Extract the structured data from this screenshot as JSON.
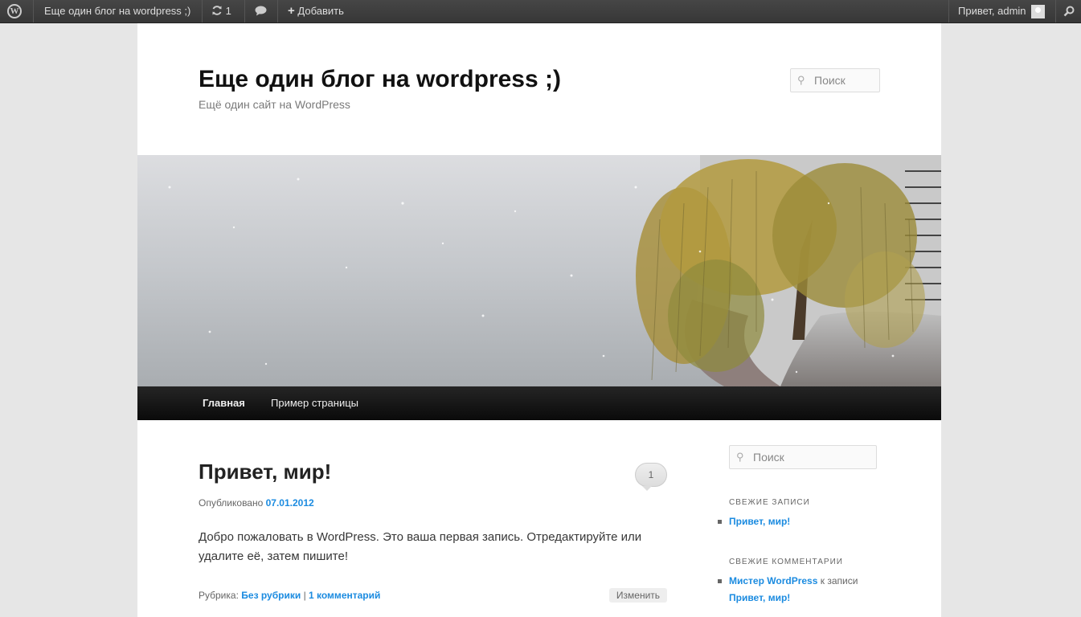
{
  "adminbar": {
    "site_name": "Еще один блог на wordpress ;)",
    "updates_count": "1",
    "add_label": "Добавить",
    "greeting": "Привет, admin"
  },
  "header": {
    "title": "Еще один блог на wordpress ;)",
    "description": "Ещё один сайт на WordPress",
    "search_placeholder": "Поиск"
  },
  "nav": {
    "items": [
      "Главная",
      "Пример страницы"
    ]
  },
  "post": {
    "title": "Привет, мир!",
    "comment_count": "1",
    "published_label": "Опубликовано",
    "date": "07.01.2012",
    "body_line1": "Добро пожаловать в WordPress. Это ваша первая запись. Отредактируйте или",
    "body_line2": "удалите её, затем пишите!",
    "category_label": "Рубрика:",
    "category": "Без рубрики",
    "separator": "|",
    "comments_link": "1 комментарий",
    "edit_label": "Изменить"
  },
  "sidebar": {
    "search_placeholder": "Поиск",
    "recent_posts_title": "СВЕЖИЕ ЗАПИСИ",
    "recent_posts": [
      "Привет, мир!"
    ],
    "recent_comments_title": "СВЕЖИЕ КОММЕНТАРИИ",
    "comment_author": "Мистер WordPress",
    "comment_on": "к записи",
    "comment_post": "Привет, мир!"
  },
  "colors": {
    "link": "#1b8be0",
    "adminbar": "#464646",
    "nav": "#111111"
  }
}
